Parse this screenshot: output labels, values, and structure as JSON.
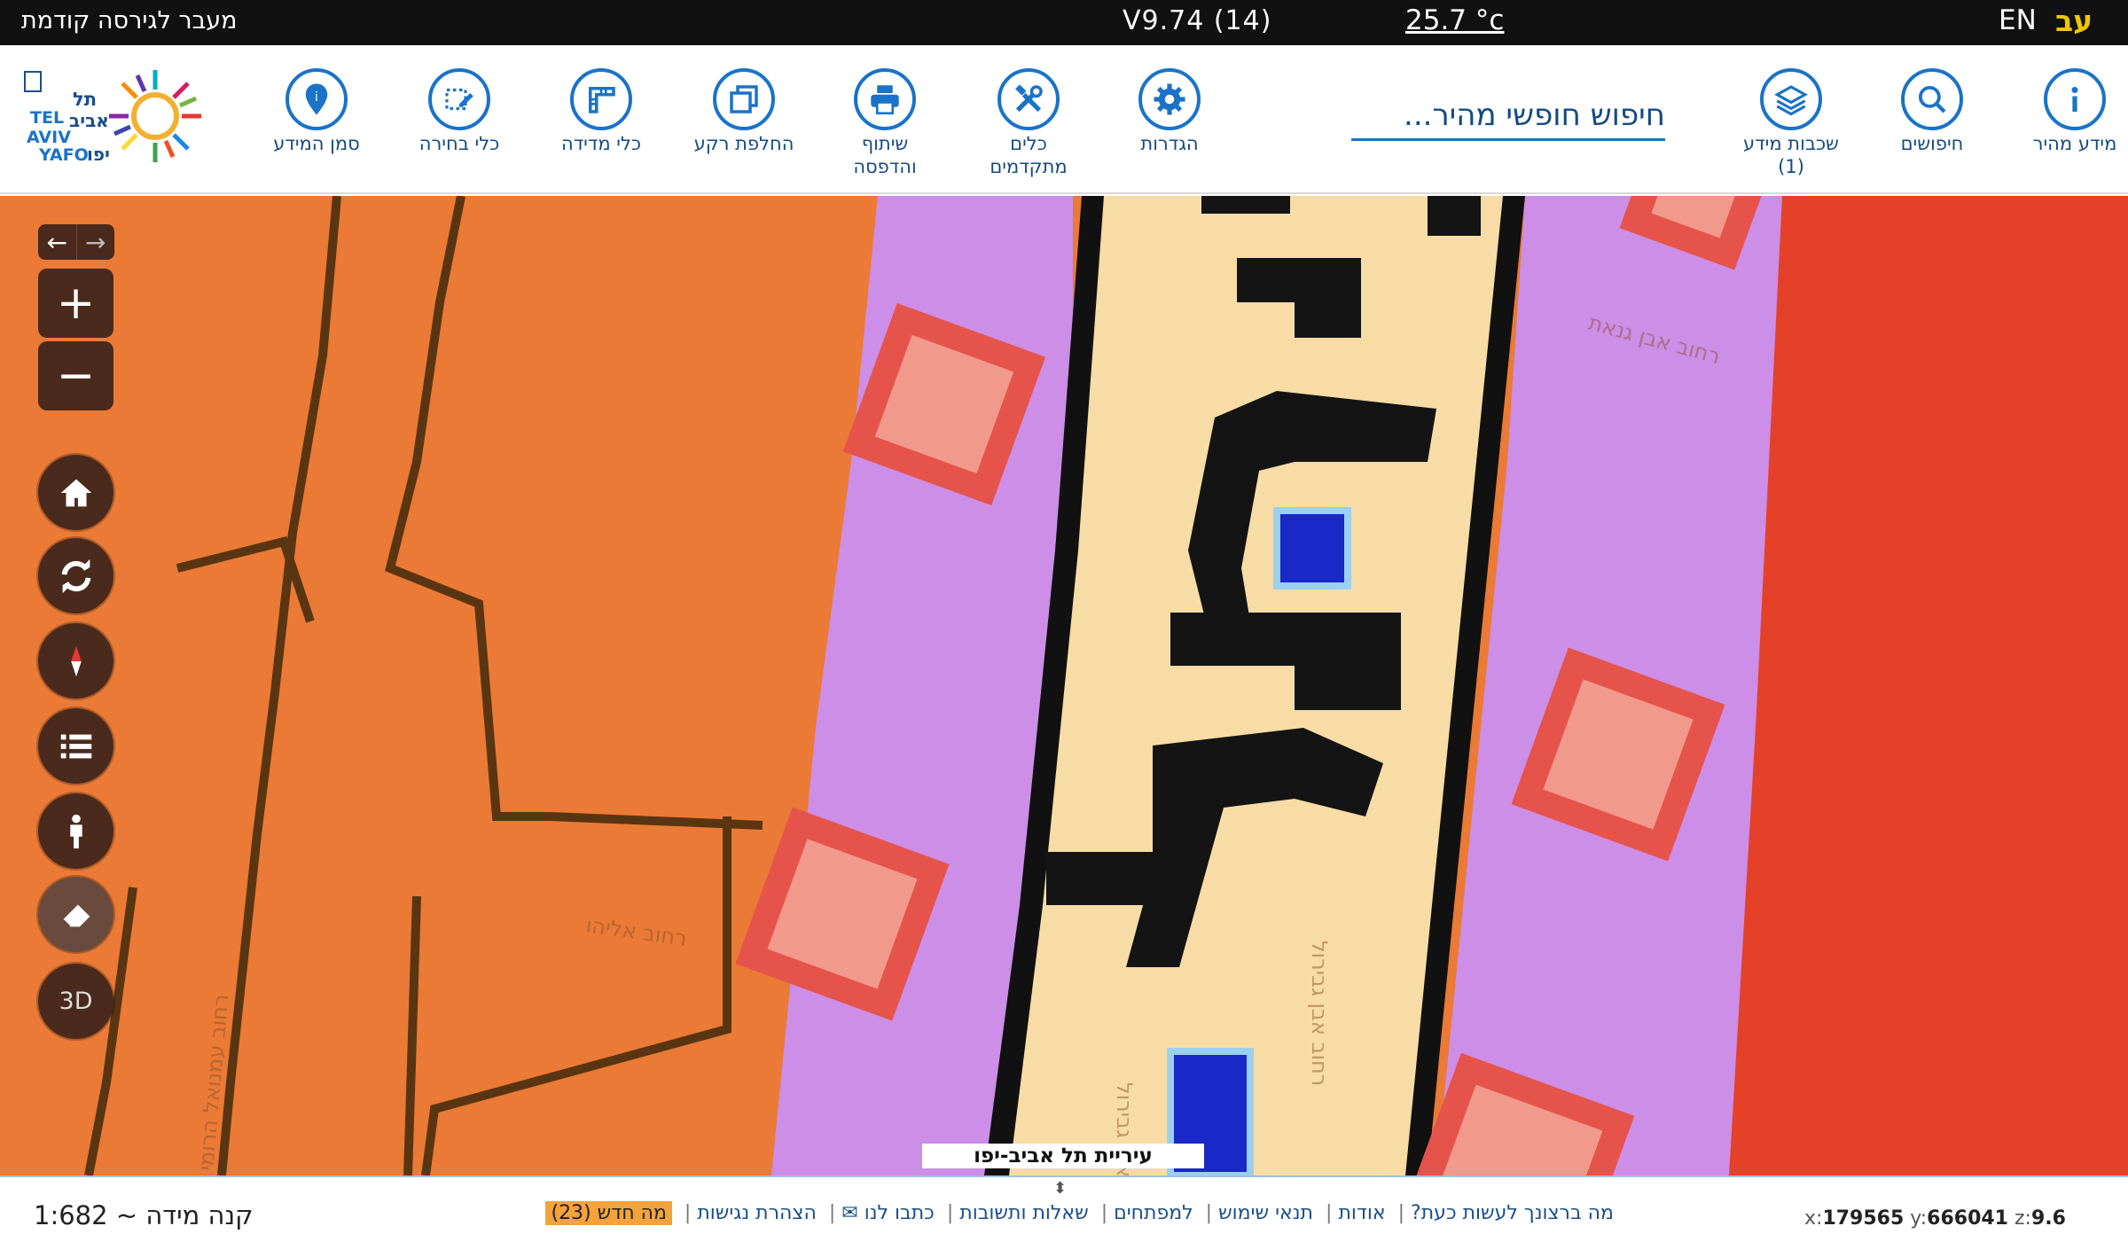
{
  "topbar": {
    "prev_version": "מעבר לגירסה קודמת",
    "version": "V9.74 (14)",
    "temperature": "25.7 °c",
    "lang_en": "EN",
    "lang_he": "עב"
  },
  "toolbar": {
    "search_placeholder": "חיפוש חופשי מהיר...",
    "tools": {
      "quick_info": "מידע מהיר",
      "searches": "חיפושים",
      "layers": "שכבות מידע",
      "layers_count": "(1)",
      "settings": "הגדרות",
      "advanced_1": "כלים",
      "advanced_2": "מתקדמים",
      "share_1": "שיתוף",
      "share_2": "והדפסה",
      "basemap": "החלפת רקע",
      "measure": "כלי מדידה",
      "select": "כלי בחירה",
      "marker": "סמן המידע"
    },
    "logo_lines": [
      "תל",
      "אביב",
      "יפו",
      "TEL",
      "AVIV",
      "YAFO"
    ]
  },
  "map": {
    "zoom_in": "+",
    "zoom_out": "−",
    "three_d": "3D",
    "city_label": "עיריית תל אביב-יפו",
    "street_labels": [
      "רחוב אבן גנאת",
      "רחוב אליהו",
      "רחוב עמנואל הרומי",
      "רחוב אבן גבירול",
      "רחוב אבן גבירול"
    ],
    "colors": {
      "orange_zone": "#ea7a35",
      "lilac_zone": "#cc8ee6",
      "road": "#f7dca5",
      "red_zone": "#e54028",
      "node": "#f19a8c",
      "controls": "#4a2a1c"
    },
    "icons": [
      "home-icon",
      "refresh-icon",
      "compass-icon",
      "list-icon",
      "person-icon",
      "eraser-icon"
    ]
  },
  "footer": {
    "scale": "קנה מידה ~ 1:682",
    "links": [
      "מה ברצונך לעשות כעת?",
      "אודות",
      "תנאי שימוש",
      "למפתחים",
      "שאלות ותשובות",
      "כתבו לנו ✉",
      "הצהרת נגישות"
    ],
    "whats_new": "מה חדש (23)",
    "coord_x_label": "x:",
    "coord_x": "179565",
    "coord_y_label": "y:",
    "coord_y": "666041",
    "coord_z_label": "z:",
    "coord_z": "9.6"
  }
}
